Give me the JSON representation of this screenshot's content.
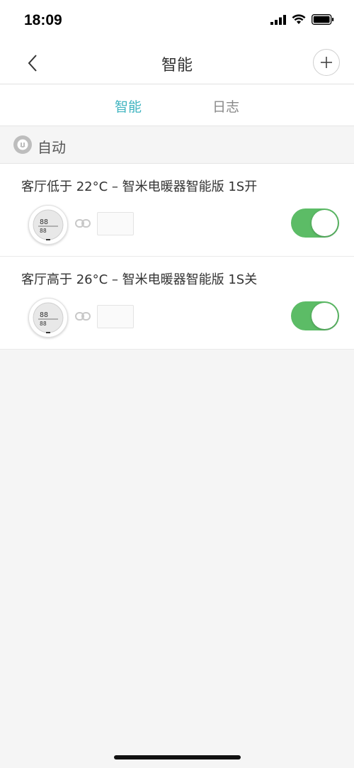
{
  "status_bar": {
    "time": "18:09"
  },
  "nav": {
    "title": "智能",
    "back_icon": "chevron-left-icon",
    "add_icon": "plus-icon"
  },
  "tabs": [
    {
      "label": "智能",
      "active": true
    },
    {
      "label": "日志",
      "active": false
    }
  ],
  "section": {
    "label": "自动",
    "icon": "auto-icon"
  },
  "rules": [
    {
      "title": "客厅低于 22°C – 智米电暖器智能版 1S开",
      "enabled": true,
      "trigger_device": "thermometer-icon",
      "action_device": "heater-icon"
    },
    {
      "title": "客厅高于 26°C – 智米电暖器智能版 1S关",
      "enabled": true,
      "trigger_device": "thermometer-icon",
      "action_device": "heater-icon"
    }
  ],
  "colors": {
    "accent": "#3fb4c0",
    "toggle_on": "#5cbc66",
    "background": "#f5f5f5"
  }
}
